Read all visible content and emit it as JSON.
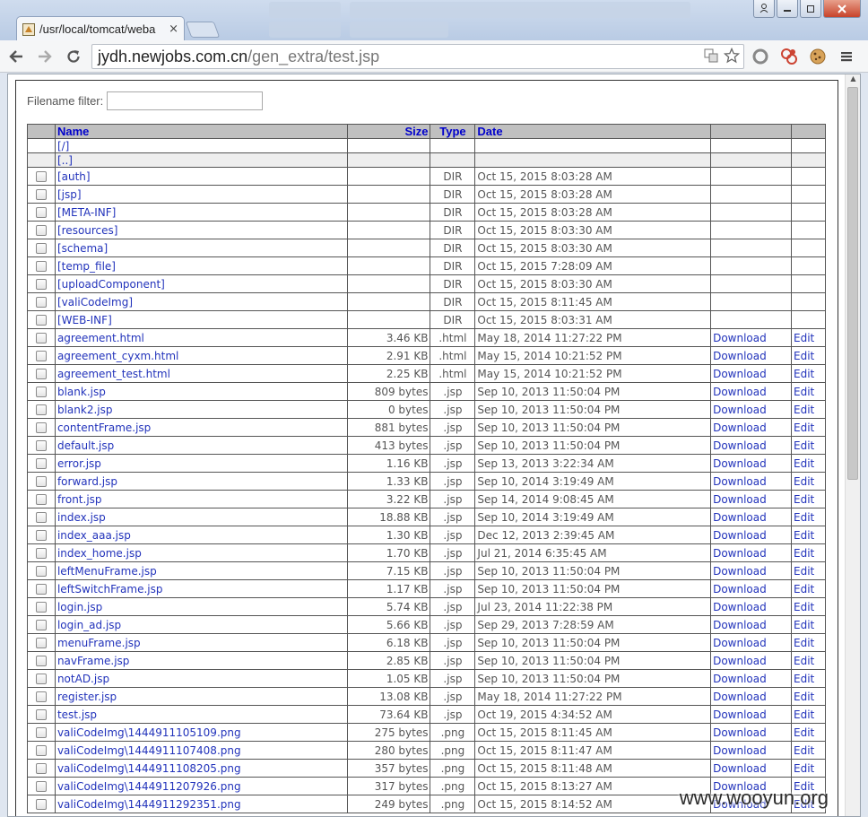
{
  "browser": {
    "tab_title": "/usr/local/tomcat/weba",
    "tab_close": "×",
    "url_host": "jydh.newjobs.com.cn",
    "url_path": "/gen_extra/test.jsp"
  },
  "filter": {
    "label": "Filename filter:",
    "value": ""
  },
  "table": {
    "headers": {
      "name": "Name",
      "size": "Size",
      "type": "Type",
      "date": "Date"
    },
    "nav_rows": [
      "[/]",
      "[..]"
    ],
    "download_label": "Download",
    "edit_label": "Edit",
    "rows": [
      {
        "name": "[auth]",
        "size": "",
        "type": "DIR",
        "date": "Oct 15, 2015 8:03:28 AM"
      },
      {
        "name": "[jsp]",
        "size": "",
        "type": "DIR",
        "date": "Oct 15, 2015 8:03:28 AM"
      },
      {
        "name": "[META-INF]",
        "size": "",
        "type": "DIR",
        "date": "Oct 15, 2015 8:03:28 AM"
      },
      {
        "name": "[resources]",
        "size": "",
        "type": "DIR",
        "date": "Oct 15, 2015 8:03:30 AM"
      },
      {
        "name": "[schema]",
        "size": "",
        "type": "DIR",
        "date": "Oct 15, 2015 8:03:30 AM"
      },
      {
        "name": "[temp_file]",
        "size": "",
        "type": "DIR",
        "date": "Oct 15, 2015 7:28:09 AM"
      },
      {
        "name": "[uploadComponent]",
        "size": "",
        "type": "DIR",
        "date": "Oct 15, 2015 8:03:30 AM"
      },
      {
        "name": "[valiCodeImg]",
        "size": "",
        "type": "DIR",
        "date": "Oct 15, 2015 8:11:45 AM"
      },
      {
        "name": "[WEB-INF]",
        "size": "",
        "type": "DIR",
        "date": "Oct 15, 2015 8:03:31 AM"
      },
      {
        "name": "agreement.html",
        "size": "3.46 KB",
        "type": ".html",
        "date": "May 18, 2014 11:27:22 PM"
      },
      {
        "name": "agreement_cyxm.html",
        "size": "2.91 KB",
        "type": ".html",
        "date": "May 15, 2014 10:21:52 PM"
      },
      {
        "name": "agreement_test.html",
        "size": "2.25 KB",
        "type": ".html",
        "date": "May 15, 2014 10:21:52 PM"
      },
      {
        "name": "blank.jsp",
        "size": "809 bytes",
        "type": ".jsp",
        "date": "Sep 10, 2013 11:50:04 PM"
      },
      {
        "name": "blank2.jsp",
        "size": "0 bytes",
        "type": ".jsp",
        "date": "Sep 10, 2013 11:50:04 PM"
      },
      {
        "name": "contentFrame.jsp",
        "size": "881 bytes",
        "type": ".jsp",
        "date": "Sep 10, 2013 11:50:04 PM"
      },
      {
        "name": "default.jsp",
        "size": "413 bytes",
        "type": ".jsp",
        "date": "Sep 10, 2013 11:50:04 PM"
      },
      {
        "name": "error.jsp",
        "size": "1.16 KB",
        "type": ".jsp",
        "date": "Sep 13, 2013 3:22:34 AM"
      },
      {
        "name": "forward.jsp",
        "size": "1.33 KB",
        "type": ".jsp",
        "date": "Sep 10, 2014 3:19:49 AM"
      },
      {
        "name": "front.jsp",
        "size": "3.22 KB",
        "type": ".jsp",
        "date": "Sep 14, 2014 9:08:45 AM"
      },
      {
        "name": "index.jsp",
        "size": "18.88 KB",
        "type": ".jsp",
        "date": "Sep 10, 2014 3:19:49 AM"
      },
      {
        "name": "index_aaa.jsp",
        "size": "1.30 KB",
        "type": ".jsp",
        "date": "Dec 12, 2013 2:39:45 AM"
      },
      {
        "name": "index_home.jsp",
        "size": "1.70 KB",
        "type": ".jsp",
        "date": "Jul 21, 2014 6:35:45 AM"
      },
      {
        "name": "leftMenuFrame.jsp",
        "size": "7.15 KB",
        "type": ".jsp",
        "date": "Sep 10, 2013 11:50:04 PM"
      },
      {
        "name": "leftSwitchFrame.jsp",
        "size": "1.17 KB",
        "type": ".jsp",
        "date": "Sep 10, 2013 11:50:04 PM"
      },
      {
        "name": "login.jsp",
        "size": "5.74 KB",
        "type": ".jsp",
        "date": "Jul 23, 2014 11:22:38 PM"
      },
      {
        "name": "login_ad.jsp",
        "size": "5.66 KB",
        "type": ".jsp",
        "date": "Sep 29, 2013 7:28:59 AM"
      },
      {
        "name": "menuFrame.jsp",
        "size": "6.18 KB",
        "type": ".jsp",
        "date": "Sep 10, 2013 11:50:04 PM"
      },
      {
        "name": "navFrame.jsp",
        "size": "2.85 KB",
        "type": ".jsp",
        "date": "Sep 10, 2013 11:50:04 PM"
      },
      {
        "name": "notAD.jsp",
        "size": "1.05 KB",
        "type": ".jsp",
        "date": "Sep 10, 2013 11:50:04 PM"
      },
      {
        "name": "register.jsp",
        "size": "13.08 KB",
        "type": ".jsp",
        "date": "May 18, 2014 11:27:22 PM"
      },
      {
        "name": "test.jsp",
        "size": "73.64 KB",
        "type": ".jsp",
        "date": "Oct 19, 2015 4:34:52 AM"
      },
      {
        "name": "valiCodeImg\\1444911105109.png",
        "size": "275 bytes",
        "type": ".png",
        "date": "Oct 15, 2015 8:11:45 AM"
      },
      {
        "name": "valiCodeImg\\1444911107408.png",
        "size": "280 bytes",
        "type": ".png",
        "date": "Oct 15, 2015 8:11:47 AM"
      },
      {
        "name": "valiCodeImg\\1444911108205.png",
        "size": "357 bytes",
        "type": ".png",
        "date": "Oct 15, 2015 8:11:48 AM"
      },
      {
        "name": "valiCodeImg\\1444911207926.png",
        "size": "317 bytes",
        "type": ".png",
        "date": "Oct 15, 2015 8:13:27 AM"
      },
      {
        "name": "valiCodeImg\\1444911292351.png",
        "size": "249 bytes",
        "type": ".png",
        "date": "Oct 15, 2015 8:14:52 AM"
      }
    ]
  },
  "watermark": "www.wooyun.org",
  "icons": {
    "back": "arrow-left-icon",
    "forward": "arrow-right-icon",
    "reload": "reload-icon",
    "menu": "hamburger-menu-icon",
    "star": "star-icon",
    "translate": "translate-icon"
  }
}
